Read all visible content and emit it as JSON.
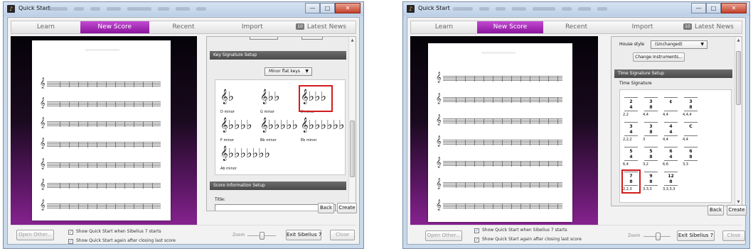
{
  "windows": [
    {
      "title": "Quick Start",
      "tabs": [
        "Learn",
        "New Score",
        "Recent",
        "Import",
        "Latest News"
      ],
      "active_tab": 1,
      "news_icon": "10",
      "key_signature": {
        "header": "Key Signature Setup",
        "dropdown_value": "Minor flat keys",
        "keys": [
          {
            "name": "D minor",
            "accidentals": "♭"
          },
          {
            "name": "G minor",
            "accidentals": "♭♭"
          },
          {
            "name": "C minor",
            "accidentals": "♭♭♭"
          },
          {
            "name": "F minor",
            "accidentals": "♭♭♭♭"
          },
          {
            "name": "Bb minor",
            "accidentals": "♭♭♭♭♭"
          },
          {
            "name": "Eb minor",
            "accidentals": "♭♭♭♭♭♭"
          },
          {
            "name": "Ab minor",
            "accidentals": "♭♭♭♭♭♭♭"
          }
        ],
        "selected": "C minor"
      },
      "score_info": {
        "header": "Score Information Setup",
        "title_label": "Title:"
      },
      "buttons": {
        "back": "Back",
        "create": "Create",
        "open_other": "Open Other...",
        "exit": "Exit Sibelius 7",
        "close": "Close"
      },
      "checkboxes": [
        "Show Quick Start when Sibelius 7 starts",
        "Show Quick Start again after closing last score"
      ],
      "zoom_label": "Zoom"
    },
    {
      "title": "Quick Start",
      "tabs": [
        "Learn",
        "New Score",
        "Recent",
        "Import",
        "Latest News"
      ],
      "active_tab": 1,
      "news_icon": "10",
      "house_style": {
        "label": "House style",
        "value": "(Unchanged)",
        "change_button": "Change Instruments..."
      },
      "time_signature": {
        "header": "Time Signature Setup",
        "sublabel": "Time Signature",
        "items": [
          {
            "top": "2",
            "bottom": "4",
            "label": "2,2"
          },
          {
            "top": "3",
            "bottom": "8",
            "label": "4,4"
          },
          {
            "top": "¢",
            "bottom": "",
            "label": "4,4"
          },
          {
            "top": "3",
            "bottom": "8",
            "label": "4,4,4"
          },
          {
            "top": "3",
            "bottom": "4",
            "label": "2,2,2"
          },
          {
            "top": "3",
            "bottom": "8",
            "label": "3"
          },
          {
            "top": "4",
            "bottom": "4",
            "label": "4,4"
          },
          {
            "top": "C",
            "bottom": "",
            "label": "4,4"
          },
          {
            "top": "5",
            "bottom": "4",
            "label": "6,4"
          },
          {
            "top": "5",
            "bottom": "8",
            "label": "3,2"
          },
          {
            "top": "6",
            "bottom": "4",
            "label": "6,6"
          },
          {
            "top": "6",
            "bottom": "8",
            "label": "3,3"
          },
          {
            "top": "7",
            "bottom": "8",
            "label": "2,2,3"
          },
          {
            "top": "9",
            "bottom": "8",
            "label": "3,3,3"
          },
          {
            "top": "12",
            "bottom": "8",
            "label": "3,3,3,3"
          }
        ],
        "selected_index": 12
      },
      "buttons": {
        "back": "Back",
        "create": "Create",
        "open_other": "Open Other...",
        "exit": "Exit Sibelius 7",
        "close": "Close"
      },
      "checkboxes": [
        "Show Quick Start when Sibelius 7 starts",
        "Show Quick Start again after closing last score"
      ],
      "zoom_label": "Zoom"
    }
  ],
  "colors": {
    "active_tab": "#a52cb6",
    "preview_glow": "#86238f",
    "selection": "#d21c1c"
  },
  "icons": {
    "app": "sibelius-app-icon",
    "clef": "treble-clef-icon"
  }
}
